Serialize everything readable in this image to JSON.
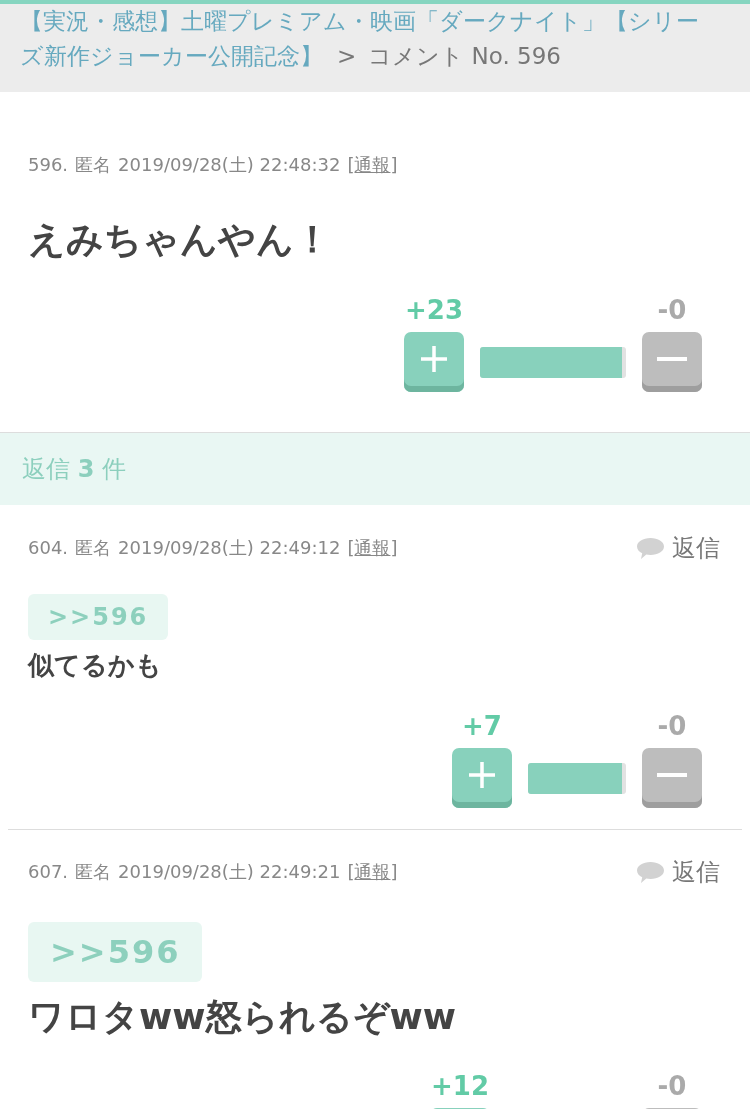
{
  "header": {
    "breadcrumb_link": "【実況・感想】土曜プレミアム・映画「ダークナイト」【シリーズ新作ジョーカー公開記念】",
    "separator": ">",
    "current": "コメント No. 596"
  },
  "comment": {
    "number": "596.",
    "author": "匿名",
    "posted_at": "2019/09/28(土) 22:48:32",
    "report": {
      "open": "[",
      "label": "通報",
      "close": "]"
    },
    "body": "えみちゃんやん！",
    "votes": {
      "plus": "+23",
      "minus": "-0",
      "level": 0.97
    }
  },
  "replies_header": {
    "title": "返信 **3** 件"
  },
  "replies": [
    {
      "kind": "plain",
      "number": "604.",
      "author": "匿名",
      "posted_at": "2019/09/28(土) 22:49:12",
      "report": {
        "open": "[",
        "label": "通報",
        "close": "]"
      },
      "reply_label": "返信",
      "quote": ">>596",
      "body": "似てるかも",
      "votes": {
        "plus": "+7",
        "minus": "-0",
        "level": 0.96
      }
    },
    {
      "kind": "emphasized",
      "number": "607.",
      "author": "匿名",
      "posted_at": "2019/09/28(土) 22:49:21",
      "report": {
        "open": "[",
        "label": "通報",
        "close": "]"
      },
      "reply_label": "返信",
      "quote": ">>596",
      "body": "ワロタww怒られるぞww",
      "votes": {
        "plus": "+12",
        "minus": "-0"
      }
    }
  ]
}
